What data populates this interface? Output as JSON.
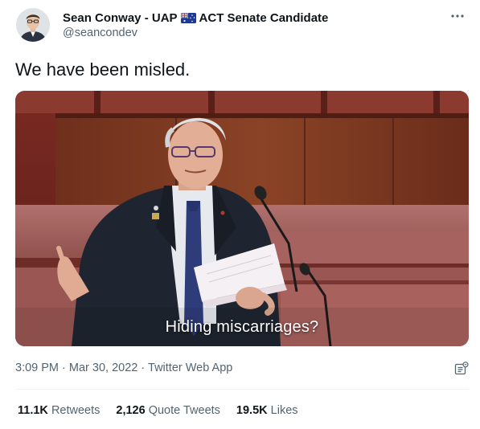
{
  "author": {
    "name": "Sean Conway - UAP",
    "name_suffix": "ACT Senate Candidate",
    "handle": "@seancondev",
    "flag_icon": "australia-flag-icon"
  },
  "tweet": {
    "text": "We have been misled."
  },
  "media": {
    "caption": "Hiding miscarriages?"
  },
  "meta": {
    "time": "3:09 PM",
    "separator": "·",
    "date": "Mar 30, 2022",
    "source": "Twitter Web App"
  },
  "stats": {
    "retweets_count": "11.1K",
    "retweets_label": "Retweets",
    "quotes_count": "2,126",
    "quotes_label": "Quote Tweets",
    "likes_count": "19.5K",
    "likes_label": "Likes"
  },
  "colors": {
    "text_primary": "#0f1419",
    "text_secondary": "#536471",
    "divider": "#eff3f4"
  }
}
